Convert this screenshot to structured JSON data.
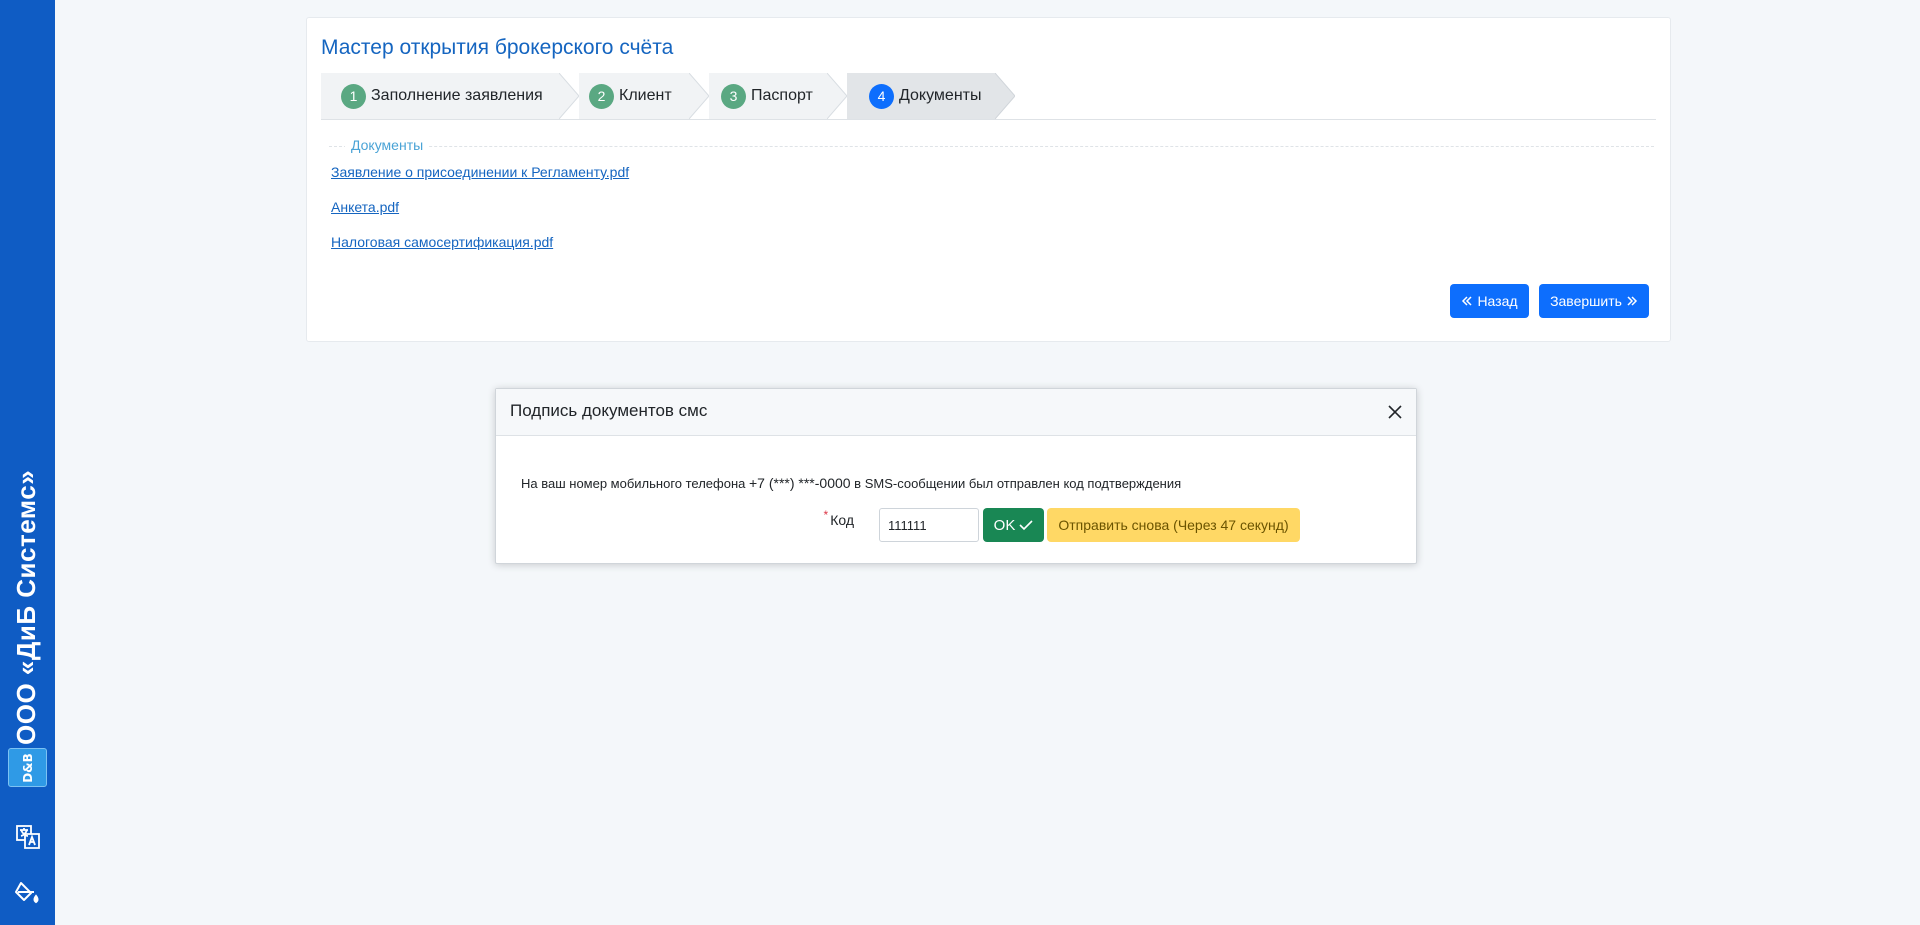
{
  "sidebar": {
    "brand_name": "ООО «ДиБ Системс»",
    "logo_text": "D&B",
    "icons": [
      "translate-icon",
      "paint-bucket-icon"
    ]
  },
  "wizard": {
    "title": "Мастер открытия брокерского счёта",
    "steps": [
      {
        "number": "1",
        "label": "Заполнение заявления"
      },
      {
        "number": "2",
        "label": "Клиент"
      },
      {
        "number": "3",
        "label": "Паспорт"
      },
      {
        "number": "4",
        "label": "Документы",
        "active": true
      }
    ],
    "section_legend": "Документы",
    "documents": [
      "Заявление о присоединении к Регламенту.pdf",
      "Анкета.pdf",
      "Налоговая самосертификация.pdf"
    ],
    "back_label": "Назад",
    "finish_label": "Завершить"
  },
  "modal": {
    "title": "Подпись документов смс",
    "message_before": "На ваш номер мобильного телефона ",
    "phone": "+7 (***) ***-0000",
    "message_after": " в SMS-сообщении был отправлен код подтверждения",
    "code_label": "Код",
    "code_value": "111111",
    "ok_label": "OK",
    "resend_label": "Отправить снова (Через 47 секунд)"
  },
  "colors": {
    "sidebar": "#0f5cc4",
    "primary": "#0d6efd",
    "success": "#198754",
    "warning": "#ffd865",
    "step_done": "#5aa882"
  }
}
